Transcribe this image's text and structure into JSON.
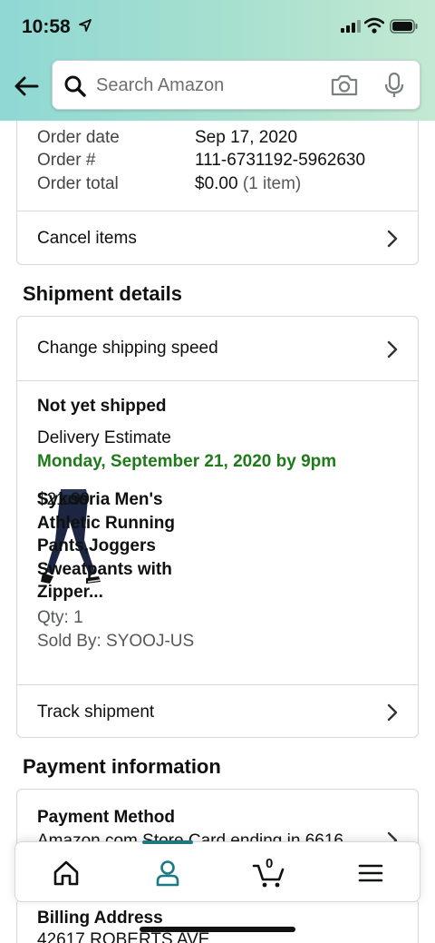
{
  "status_bar": {
    "time": "10:58"
  },
  "search": {
    "placeholder": "Search Amazon"
  },
  "order_summary": {
    "rows": [
      {
        "label": "Order date",
        "value": "Sep 17, 2020",
        "extra": ""
      },
      {
        "label": "Order #",
        "value": "111-6731192-5962630",
        "extra": ""
      },
      {
        "label": "Order total",
        "value": "$0.00",
        "extra": "(1 item)"
      }
    ],
    "cancel_label": "Cancel items"
  },
  "shipment": {
    "section_title": "Shipment details",
    "change_speed_label": "Change shipping speed",
    "status": "Not yet shipped",
    "estimate_label": "Delivery Estimate",
    "estimate_date": "Monday, September 21, 2020 by 9pm",
    "item": {
      "name": "Sykooria Men's Athletic Running Pants,Joggers Sweatpants with Zipper...",
      "price": "$21.99",
      "qty": "Qty: 1",
      "sold_by": "Sold By: SYOOJ-US"
    },
    "track_label": "Track shipment"
  },
  "payment": {
    "section_title": "Payment information",
    "method_title": "Payment Method",
    "method_detail": "Amazon.com Store Card ending in 6616",
    "billing_title": "Billing Address",
    "billing_line": "42617 ROBERTS AVE"
  },
  "nav": {
    "cart_count": "0",
    "active": "account"
  },
  "colors": {
    "accent": "#1a7b84",
    "delivery_green": "#1f7a1a",
    "header_start": "#8fd8d4",
    "header_end": "#c3e9d2"
  }
}
